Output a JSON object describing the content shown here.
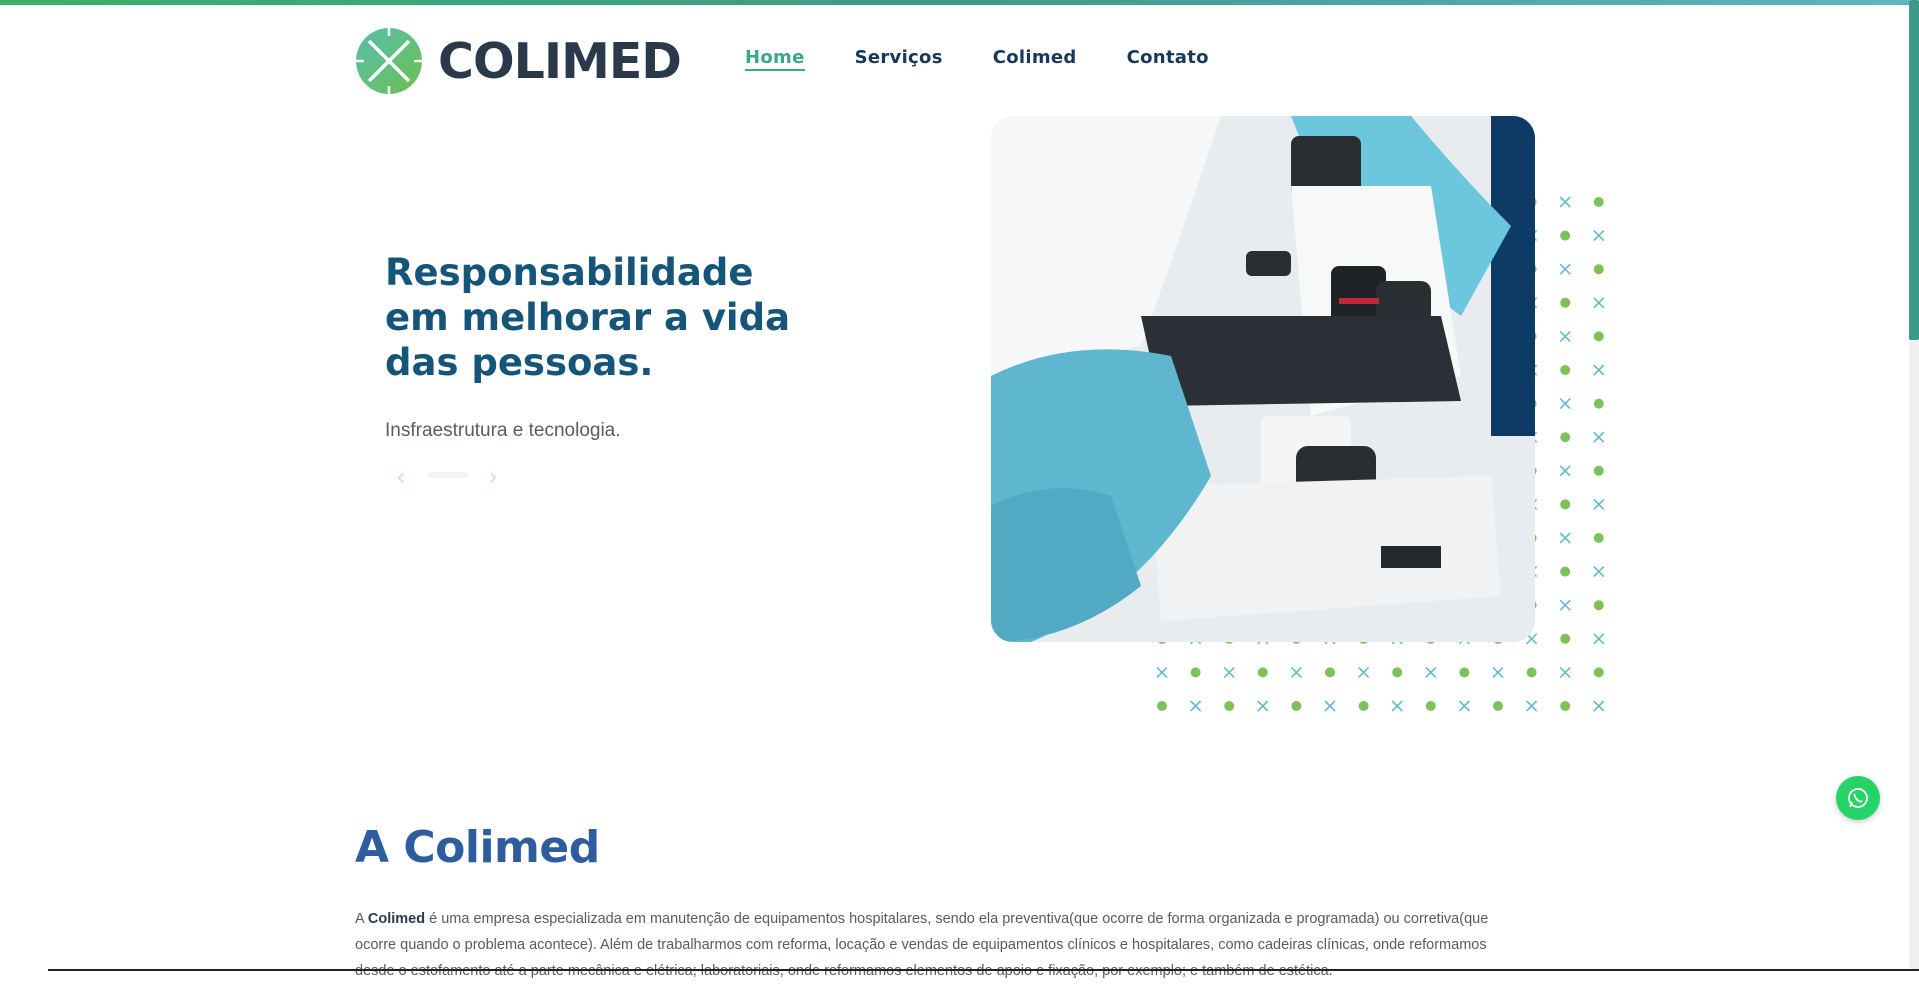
{
  "header": {
    "logo_text": "COLIMED",
    "nav": [
      {
        "label": "Home",
        "active": true
      },
      {
        "label": "Serviços",
        "active": false
      },
      {
        "label": "Colimed",
        "active": false
      },
      {
        "label": "Contato",
        "active": false
      }
    ]
  },
  "hero": {
    "title": "Responsabilidade em melhorar a vida das pessoas.",
    "subtitle": "Insfraestrutura e tecnologia.",
    "prev_icon": "chevron-left-icon",
    "next_icon": "chevron-right-icon"
  },
  "about": {
    "title": "A Colimed",
    "intro_prefix": "A ",
    "intro_brand": "Colimed",
    "intro_text": " é uma empresa especializada em manutenção de equipamentos hospitalares, sendo ela preventiva(que ocorre de forma organizada e programada) ou corretiva(que ocorre quando o problema acontece). Além de trabalharmos com reforma, locação e vendas de equipamentos clínicos e hospitalares, como cadeiras clínicas, onde reformamos desde o estofamento até a parte mecânica e elétrica; laboratoriais, onde reformamos elementos de apoio e fixação, por exemplo; e também de estética."
  },
  "colors": {
    "primary": "#15557a",
    "accent_green": "#3aa98a",
    "about_title": "#2e5d9f",
    "whatsapp": "#25d366"
  },
  "icons": {
    "whatsapp": "whatsapp-icon",
    "logo": "logo-x-icon"
  }
}
